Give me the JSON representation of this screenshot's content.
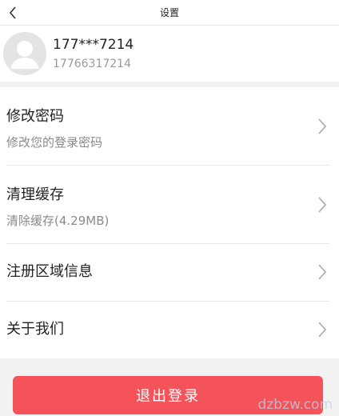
{
  "header": {
    "title": "设置",
    "back_icon": "chevron-left-icon"
  },
  "user": {
    "nickname": "177***7214",
    "phone": "17766317214",
    "avatar_icon": "default-avatar-icon"
  },
  "settings": [
    {
      "title": "修改密码",
      "subtitle": "修改您的登录密码"
    },
    {
      "title": "清理缓存",
      "subtitle": "清除缓存(4.29MB)"
    },
    {
      "title": "注册区域信息"
    },
    {
      "title": "关于我们"
    }
  ],
  "chevron_icon": "chevron-right-icon",
  "logout": {
    "label": "退出登录"
  },
  "watermark": "dzbzw.com",
  "colors": {
    "accent": "#f5535a",
    "background": "#f2f2f2",
    "subtext": "#8a8a8a"
  }
}
